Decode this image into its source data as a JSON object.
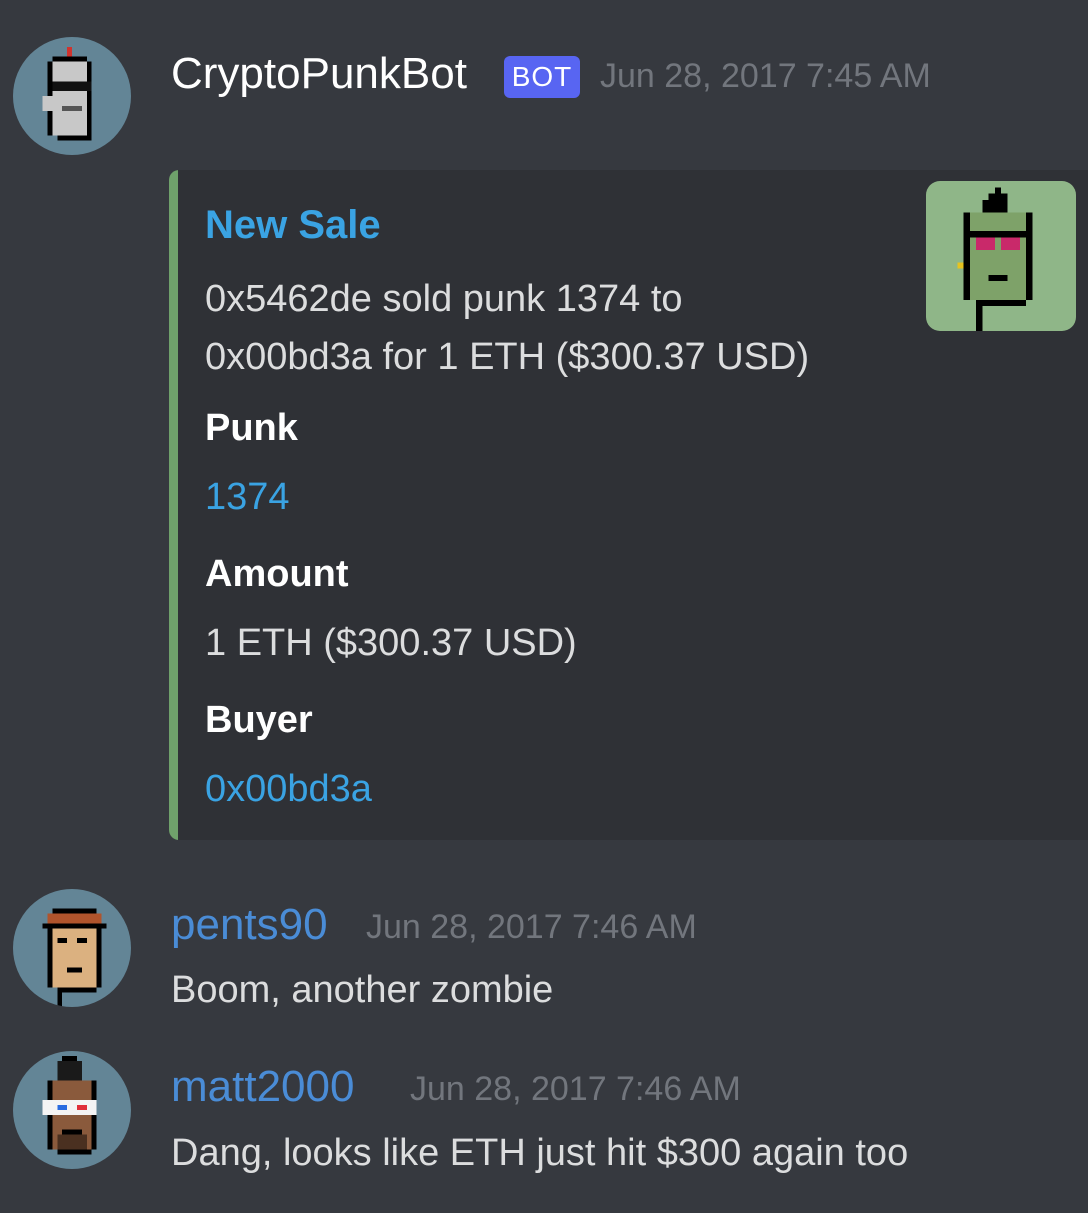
{
  "messages": [
    {
      "author": "CryptoPunkBot",
      "bot_tag": "BOT",
      "timestamp": "Jun 28, 2017 7:45 AM",
      "embed": {
        "title": "New Sale",
        "description_line1": "0x5462de sold punk 1374 to",
        "description_line2": "0x00bd3a for 1 ETH ($300.37 USD)",
        "fields": [
          {
            "name": "Punk",
            "value": "1374"
          },
          {
            "name": "Amount",
            "value": "1 ETH ($300.37 USD)"
          },
          {
            "name": "Buyer",
            "value": "0x00bd3a"
          }
        ],
        "accent_color": "#6fa16b"
      }
    },
    {
      "author": "pents90",
      "timestamp": "Jun 28, 2017 7:46 AM",
      "text": "Boom, another zombie"
    },
    {
      "author": "matt2000",
      "timestamp": "Jun 28, 2017 7:46 AM",
      "text": "Dang, looks like ETH just hit $300 again too"
    }
  ],
  "colors": {
    "background": "#36393f",
    "embed_background": "#2f3136",
    "link": "#3aa3e3",
    "username": "#4a8cd6",
    "bot_tag": "#5865f2",
    "timestamp": "#72767d"
  }
}
